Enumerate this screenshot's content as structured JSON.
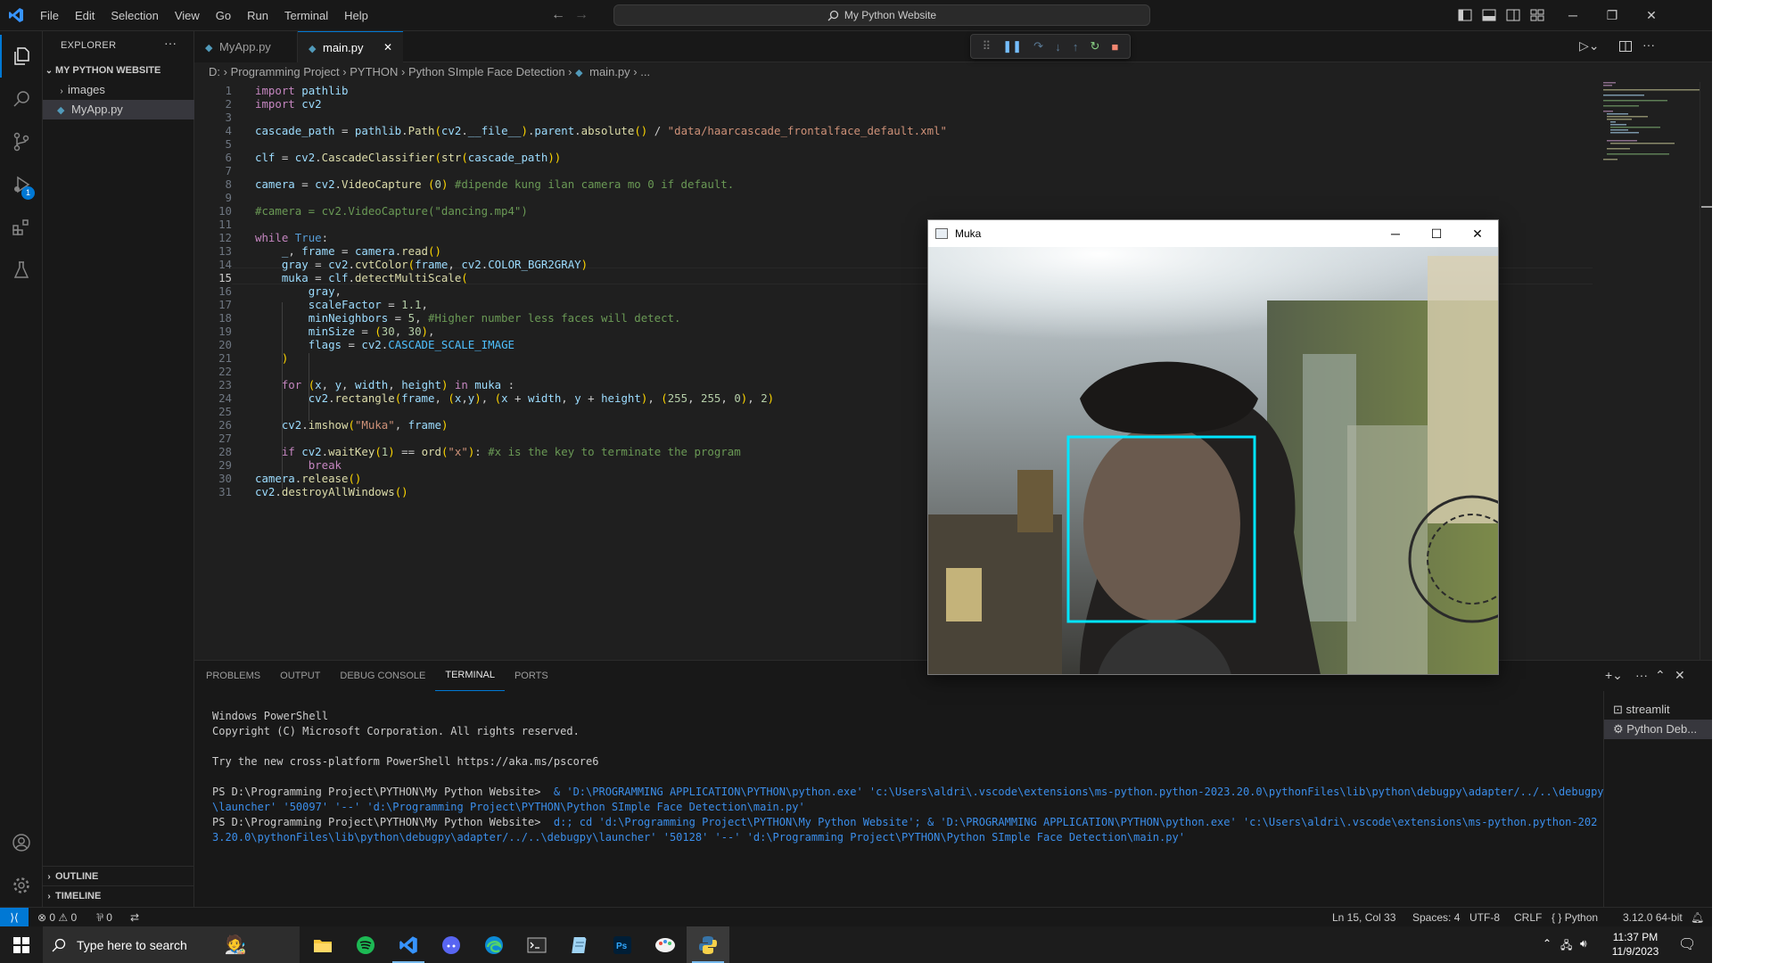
{
  "menu": [
    "File",
    "Edit",
    "Selection",
    "View",
    "Go",
    "Run",
    "Terminal",
    "Help"
  ],
  "search": {
    "label": "My Python Website"
  },
  "explorer": {
    "title": "EXPLORER",
    "folder": "MY PYTHON WEBSITE",
    "items": [
      "images",
      "MyApp.py"
    ],
    "outline": "OUTLINE",
    "timeline": "TIMELINE"
  },
  "tabs": [
    {
      "label": "MyApp.py",
      "active": false
    },
    {
      "label": "main.py",
      "active": true
    }
  ],
  "breadcrumb": [
    "D:",
    "Programming Project",
    "PYTHON",
    "Python SImple Face Detection",
    "main.py",
    "..."
  ],
  "activity_badge": "1",
  "code": {
    "current_line": 15,
    "lines": [
      "import pathlib",
      "import cv2",
      "",
      "cascade_path = pathlib.Path(cv2.__file__).parent.absolute() / \"data/haarcascade_frontalface_default.xml\"",
      "",
      "clf = cv2.CascadeClassifier(str(cascade_path))",
      "",
      "camera = cv2.VideoCapture (0) #dipende kung ilan camera mo 0 if default.",
      "",
      "#camera = cv2.VideoCapture(\"dancing.mp4\")",
      "",
      "while True:",
      "    _, frame = camera.read()",
      "    gray = cv2.cvtColor(frame, cv2.COLOR_BGR2GRAY)",
      "    muka = clf.detectMultiScale(",
      "        gray,",
      "        scaleFactor = 1.1,",
      "        minNeighbors = 5, #Higher number less faces will detect.",
      "        minSize = (30, 30),",
      "        flags = cv2.CASCADE_SCALE_IMAGE",
      "    )",
      "",
      "    for (x, y, width, height) in muka :",
      "        cv2.rectangle(frame, (x,y), (x + width, y + height), (255, 255, 0), 2)",
      "",
      "    cv2.imshow(\"Muka\", frame)",
      "",
      "    if cv2.waitKey(1) == ord(\"x\"): #x is the key to terminate the program",
      "        break",
      "camera.release()",
      "cv2.destroyAllWindows()"
    ]
  },
  "panel": {
    "tabs": [
      "PROBLEMS",
      "OUTPUT",
      "DEBUG CONSOLE",
      "TERMINAL",
      "PORTS"
    ],
    "active_tab": "TERMINAL",
    "terminal_lines": [
      "Windows PowerShell",
      "Copyright (C) Microsoft Corporation. All rights reserved.",
      "",
      "Try the new cross-platform PowerShell https://aka.ms/pscore6",
      ""
    ],
    "cmd1_prompt": "PS D:\\Programming Project\\PYTHON\\My Python Website> ",
    "cmd1_text": " & 'D:\\PROGRAMMING APPLICATION\\PYTHON\\python.exe' 'c:\\Users\\aldri\\.vscode\\extensions\\ms-python.python-2023.20.0\\pythonFiles\\lib\\python\\debugpy\\adapter/../..\\debugpy\\launcher' '50097' '--' 'd:\\Programming Project\\PYTHON\\Python SImple Face Detection\\main.py'",
    "cmd2_prompt": "PS D:\\Programming Project\\PYTHON\\My Python Website> ",
    "cmd2_text": " d:; cd 'd:\\Programming Project\\PYTHON\\My Python Website'; & 'D:\\PROGRAMMING APPLICATION\\PYTHON\\python.exe' 'c:\\Users\\aldri\\.vscode\\extensions\\ms-python.python-2023.20.0\\pythonFiles\\lib\\python\\debugpy\\adapter/../..\\debugpy\\launcher' '50128' '--' 'd:\\Programming Project\\PYTHON\\Python SImple Face Detection\\main.py'",
    "terminals": [
      "streamlit",
      "Python Deb..."
    ]
  },
  "status": {
    "errors": "0",
    "warnings": "0",
    "ports": "0",
    "position": "Ln 15, Col 33",
    "spaces": "Spaces: 4",
    "encoding": "UTF-8",
    "eol": "CRLF",
    "language": "Python",
    "interpreter": "3.12.0 64-bit"
  },
  "camera_window": {
    "title": "Muka",
    "face_box_color": "#00e5ff"
  },
  "taskbar": {
    "search_placeholder": "Type here to search",
    "time": "11:37 PM",
    "date": "11/9/2023",
    "apps": [
      "file-explorer",
      "spotify",
      "vscode",
      "discord",
      "edge",
      "terminal",
      "notepad",
      "photoshop",
      "paint",
      "python"
    ]
  },
  "colors": {
    "accent": "#0078d4",
    "editor_bg": "#1f1f1f",
    "sidebar_bg": "#181818"
  }
}
